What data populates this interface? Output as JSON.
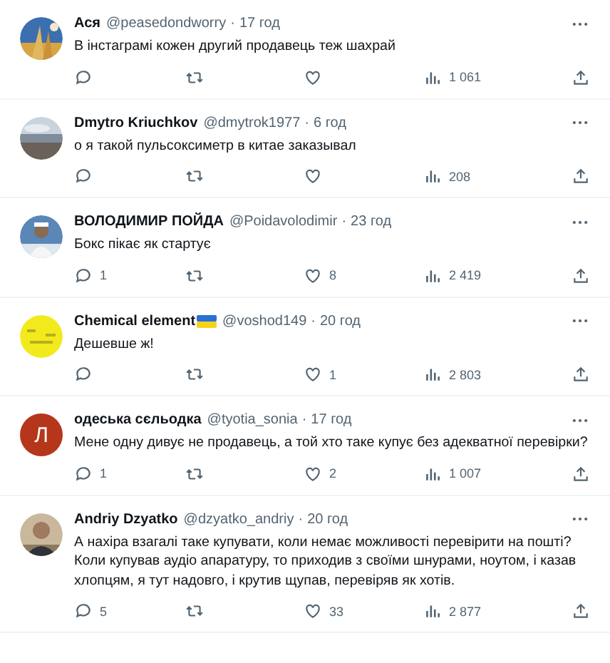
{
  "replies": [
    {
      "name": "Ася",
      "handle": "@peasedondworry",
      "separator": "·",
      "time": "17 год",
      "flag": false,
      "text": "В інстаграмі кожен другий продавець теж шахрай",
      "views": "1 061"
    },
    {
      "name": "Dmytro Kriuchkov",
      "handle": "@dmytrok1977",
      "separator": "·",
      "time": "6 год",
      "flag": false,
      "text": "о я такой пульсоксиметр в китае заказывал",
      "views": "208"
    },
    {
      "name": "ВОЛОДИМИР ПОЙДА",
      "handle": "@Poidavolodimir",
      "separator": "·",
      "time": "23 год",
      "flag": false,
      "text": "Бокс пікає як стартує",
      "replies": "1",
      "likes": "8",
      "views": "2 419"
    },
    {
      "name": "Chemical element",
      "handle": "@voshod149",
      "separator": "·",
      "time": "20 год",
      "flag": true,
      "text": "Дешевше ж!",
      "likes": "1",
      "views": "2 803"
    },
    {
      "avatar": {
        "kind": "letter",
        "letter": "Л",
        "color": "#b5361a"
      },
      "name": "одеська сєльодка",
      "handle": "@tyotia_sonia",
      "separator": "·",
      "time": "17 год",
      "flag": false,
      "text": "Мене одну дивує не продавець, а той хто таке купує без адекватної перевірки?",
      "replies": "1",
      "likes": "2",
      "views": "1 007"
    },
    {
      "name": "Andriy Dzyatko",
      "handle": "@dzyatko_andriy",
      "separator": "·",
      "time": "20 год",
      "flag": false,
      "text": "А нахіра взагалі таке купувати, коли немає можливості перевірити на пошті? Коли купував аудіо апаратуру, то приходив з своїми шнурами, ноутом, і казав хлопцям, я тут надовго, і крутив щупав, перевіряв як хотів.",
      "replies": "5",
      "likes": "33",
      "views": "2 877"
    }
  ]
}
